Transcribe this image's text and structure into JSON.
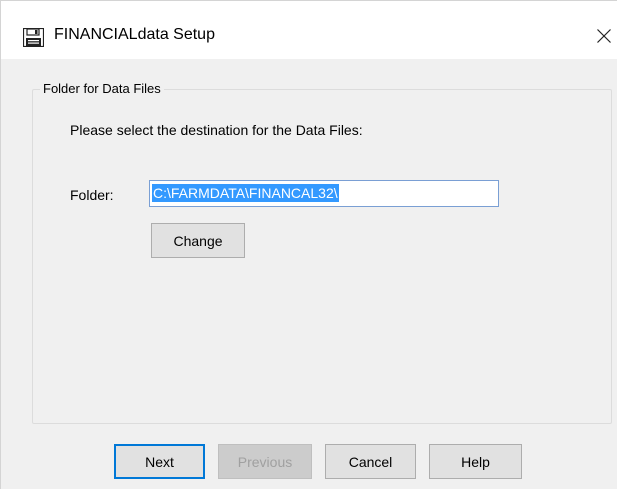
{
  "window": {
    "title": "FINANCIALdata Setup",
    "icon": "floppy-disk-icon",
    "close_icon": "close-icon"
  },
  "group": {
    "legend": "Folder for Data Files",
    "prompt": "Please select the destination for the Data Files:"
  },
  "folder": {
    "label": "Folder:",
    "value": "C:\\FARMDATA\\FINANCAL32\\"
  },
  "buttons": {
    "change": "Change",
    "next": "Next",
    "previous": "Previous",
    "cancel": "Cancel",
    "help": "Help"
  },
  "colors": {
    "selection": "#3399ff",
    "focus_border": "#0078d7"
  }
}
